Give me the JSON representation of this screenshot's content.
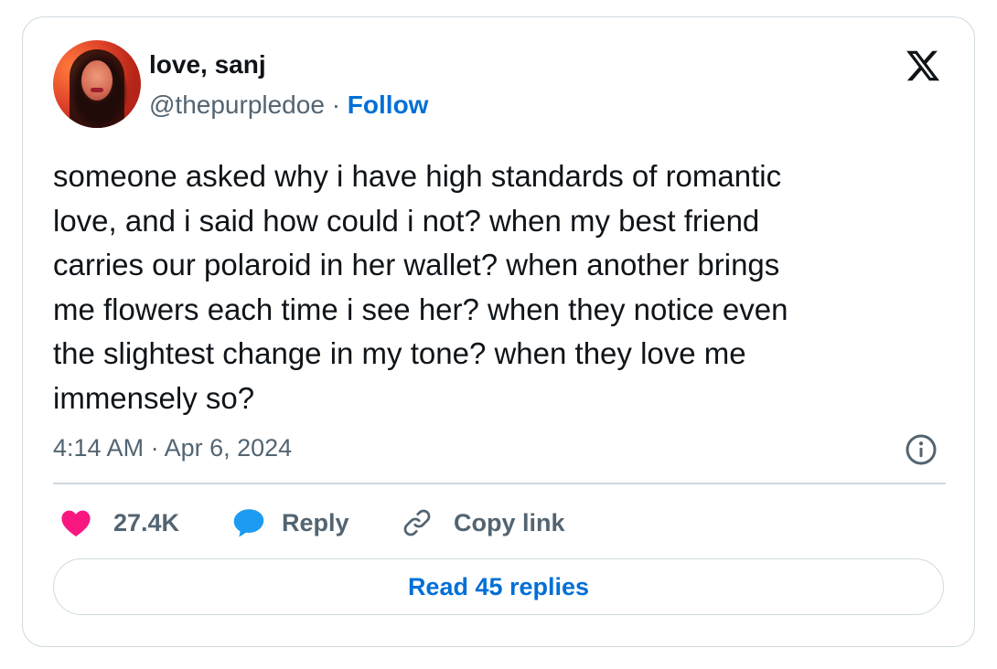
{
  "author": {
    "display_name": "love, sanj",
    "handle": "@thepurpledoe",
    "separator": "·",
    "follow_label": "Follow"
  },
  "tweet": {
    "text": "someone asked why i have high standards of romantic\nlove, and i said how could i not? when my best friend\ncarries our polaroid in her wallet? when another brings\nme flowers each time i see her? when they notice even\nthe slightest change in my tone? when they love me\nimmensely so?",
    "timestamp": "4:14 AM · Apr 6, 2024"
  },
  "actions": {
    "like_count": "27.4K",
    "reply_label": "Reply",
    "copy_link_label": "Copy link",
    "read_replies_label": "Read 45 replies"
  },
  "colors": {
    "like_heart": "#f91880",
    "reply_bubble": "#1d9bf0",
    "follow_link": "#006fd6",
    "secondary_text": "#536471",
    "border": "#cfd9de"
  },
  "icons": {
    "brand": "x-logo-icon",
    "info": "info-icon",
    "like": "heart-icon",
    "reply": "speech-bubble-icon",
    "copy": "link-icon"
  }
}
